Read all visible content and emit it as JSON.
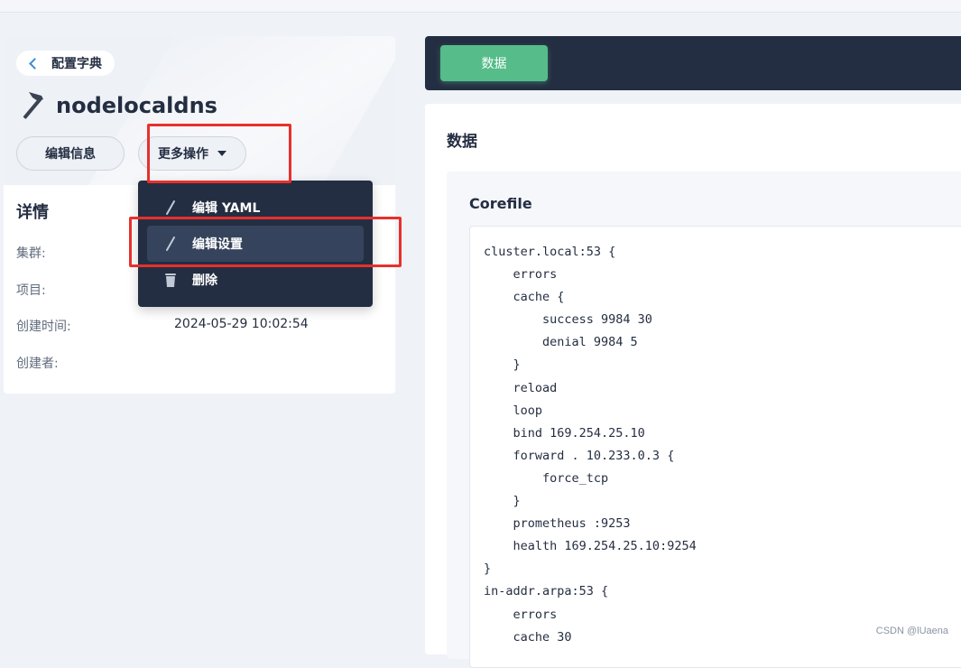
{
  "breadcrumb": {
    "back_label": "配置字典"
  },
  "resource": {
    "name": "nodelocaldns"
  },
  "actions": {
    "edit_info_label": "编辑信息",
    "more_actions_label": "更多操作"
  },
  "dropdown": {
    "items": [
      {
        "label": "编辑 YAML",
        "icon": "pencil-icon"
      },
      {
        "label": "编辑设置",
        "icon": "pencil-icon"
      },
      {
        "label": "删除",
        "icon": "trash-icon"
      }
    ]
  },
  "details": {
    "title": "详情",
    "rows": [
      {
        "label": "集群:",
        "value": ""
      },
      {
        "label": "项目:",
        "value": ""
      },
      {
        "label": "创建时间:",
        "value": "2024-05-29 10:02:54"
      },
      {
        "label": "创建者:",
        "value": ""
      }
    ]
  },
  "tabs": {
    "data_label": "数据"
  },
  "data_section": {
    "title": "数据",
    "key": "Corefile",
    "lines": [
      "cluster.local:53 {",
      "    errors",
      "    cache {",
      "        success 9984 30",
      "        denial 9984 5",
      "    }",
      "    reload",
      "    loop",
      "    bind 169.254.25.10",
      "    forward . 10.233.0.3 {",
      "        force_tcp",
      "    }",
      "    prometheus :9253",
      "    health 169.254.25.10:9254",
      "}",
      "in-addr.arpa:53 {",
      "    errors",
      "    cache 30"
    ]
  },
  "watermark": "CSDN @lUaena",
  "colors": {
    "accent_green": "#55bc8a",
    "dark": "#242e42",
    "highlight_red": "#e8302c",
    "link_blue": "#3c8cd6"
  }
}
